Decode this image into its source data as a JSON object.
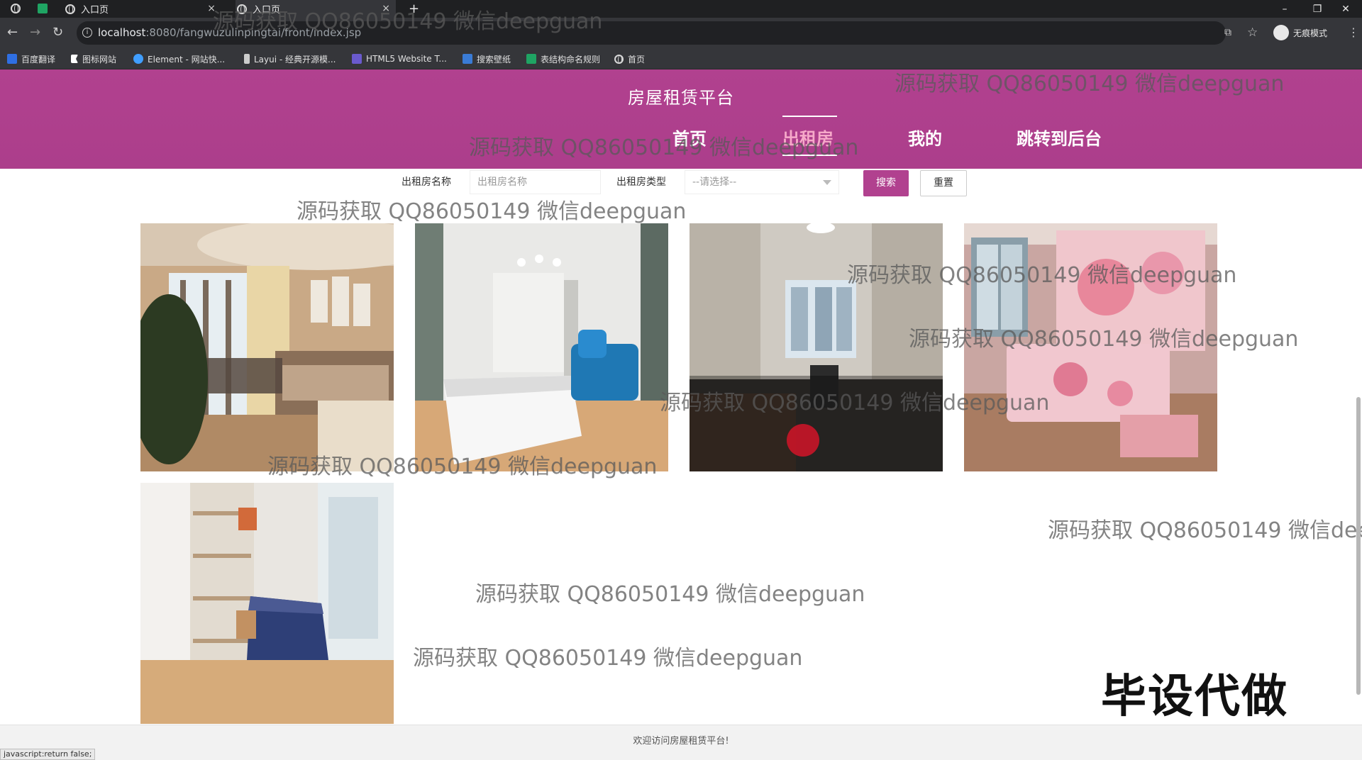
{
  "browser": {
    "tabs": [
      {
        "title": "入口页",
        "close": "×"
      },
      {
        "title": "入口页",
        "close": "×"
      }
    ],
    "new_tab": "+",
    "window_controls": {
      "minimize": "–",
      "restore": "❐",
      "close": "✕"
    },
    "nav": {
      "back": "←",
      "forward": "→",
      "reload": "↻"
    },
    "url_host": "localhost",
    "url_rest": ":8080/fangwuzulinpingtai/front/index.jsp",
    "incognito_label": "无痕模式",
    "menu": "⋮",
    "star": "☆",
    "translate": "⧉",
    "bookmarks": [
      {
        "label": "百度翻译",
        "icon": "baidu-translate-icon",
        "color": "#2f6fe3"
      },
      {
        "label": "图标网站",
        "icon": "flag-icon",
        "color": "#ffffff"
      },
      {
        "label": "Element - 网站快...",
        "icon": "element-icon",
        "color": "#409eff"
      },
      {
        "label": "Layui - 经典开源模...",
        "icon": "layui-icon",
        "color": "#cccccc"
      },
      {
        "label": "HTML5 Website T...",
        "icon": "html5-icon",
        "color": "#6a5acd"
      },
      {
        "label": "搜索壁纸",
        "icon": "wallpaper-icon",
        "color": "#3a7bd5"
      },
      {
        "label": "表结构命名规则",
        "icon": "sheet-icon",
        "color": "#1fa463"
      },
      {
        "label": "首页",
        "icon": "globe-icon",
        "color": "#cccccc"
      }
    ]
  },
  "site": {
    "title": "房屋租赁平台",
    "nav": [
      {
        "label": "首页",
        "active": false
      },
      {
        "label": "出租房",
        "active": true
      },
      {
        "label": "我的",
        "active": false
      },
      {
        "label": "跳转到后台",
        "active": false
      }
    ],
    "brand_color": "#b1418f"
  },
  "search": {
    "name_label": "出租房名称",
    "name_placeholder": "出租房名称",
    "type_label": "出租房类型",
    "type_selected": "--请选择--",
    "search_button": "搜索",
    "reset_button": "重置"
  },
  "listings": [
    {
      "image": "living-room-photo"
    },
    {
      "image": "bedroom-white-photo"
    },
    {
      "image": "room-window-photo"
    },
    {
      "image": "pink-bedroom-photo"
    },
    {
      "image": "small-bedroom-photo"
    }
  ],
  "watermark_text": "源码获取 QQ86050149 微信deepguan",
  "watermark_partial": "源码获取 QQ86050149 微信dee",
  "corner_stamp": "毕设代做",
  "footer_text": "欢迎访问房屋租赁平台!",
  "status_text": "javascript:return false;"
}
